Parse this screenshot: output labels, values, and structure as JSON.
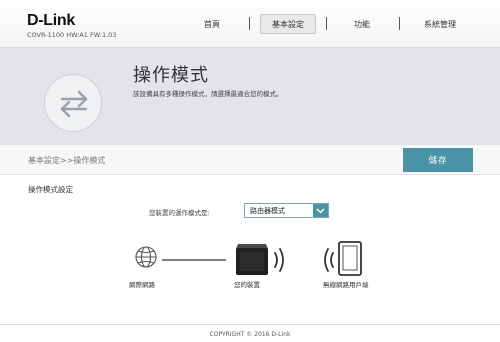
{
  "brand": {
    "logo": "D-Link",
    "model_info": "COVR-1100 HW:A1 FW:1.03"
  },
  "nav": {
    "items": [
      "首頁",
      "基本設定",
      "功能",
      "系統管理"
    ],
    "active": "基本設定"
  },
  "page": {
    "title": "操作模式",
    "description": "該設備具有多種操作模式，請選擇最適合您的模式。",
    "icon": "swap-arrows-icon"
  },
  "breadcrumb": "基本設定>>操作模式",
  "toolbar": {
    "save_label": "儲存"
  },
  "section": {
    "title": "操作模式設定"
  },
  "operation_mode": {
    "label": "您裝置的運作模式是:",
    "selected": "路由器模式"
  },
  "diagram": {
    "internet_label": "網際網路",
    "device_label": "您的裝置",
    "client_label": "無線網路用戶端"
  },
  "colors": {
    "accent": "#4a93a6",
    "band": "#e2e4e7"
  },
  "footer": {
    "copyright": "COPYRIGHT © 2016 D-Link"
  }
}
